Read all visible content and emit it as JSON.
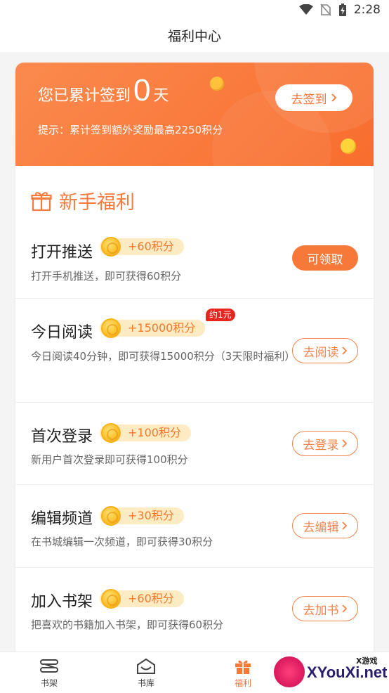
{
  "status_bar": {
    "time": "2:28"
  },
  "nav": {
    "title": "福利中心"
  },
  "banner": {
    "prefix": "您已累计签到",
    "count": "0",
    "unit": "天",
    "tip": "提示：累计签到额外奖励最高2250积分",
    "button_label": "去签到"
  },
  "section": {
    "title": "新手福利"
  },
  "tasks": [
    {
      "name": "打开推送",
      "reward": "+60积分",
      "desc": "打开手机推送，即可获得60积分",
      "button": "可领取",
      "badge": ""
    },
    {
      "name": "今日阅读",
      "reward": "+15000积分",
      "desc": "今日阅读40分钟，即可获得15000积分（3天限时福利）",
      "button": "去阅读",
      "badge": "约1元"
    },
    {
      "name": "首次登录",
      "reward": "+100积分",
      "desc": "新用户首次登录即可获得100积分",
      "button": "去登录",
      "badge": ""
    },
    {
      "name": "编辑频道",
      "reward": "+30积分",
      "desc": "在书城编辑一次频道，即可获得30积分",
      "button": "去编辑",
      "badge": ""
    },
    {
      "name": "加入书架",
      "reward": "+60积分",
      "desc": "把喜欢的书籍加入书架，即可获得60积分",
      "button": "去加书",
      "badge": ""
    }
  ],
  "tabbar": {
    "items": [
      {
        "label": "书架",
        "icon": "bookshelf-icon"
      },
      {
        "label": "书库",
        "icon": "library-icon"
      },
      {
        "label": "福利",
        "icon": "gift-icon"
      }
    ],
    "active": "福利"
  },
  "watermark": {
    "text": "XYouXi.net",
    "small": "X游戏"
  },
  "colors": {
    "accent": "#f6793a",
    "banner": "#f86d2e",
    "badge": "#e8251e",
    "pill": "#fdebc3"
  }
}
